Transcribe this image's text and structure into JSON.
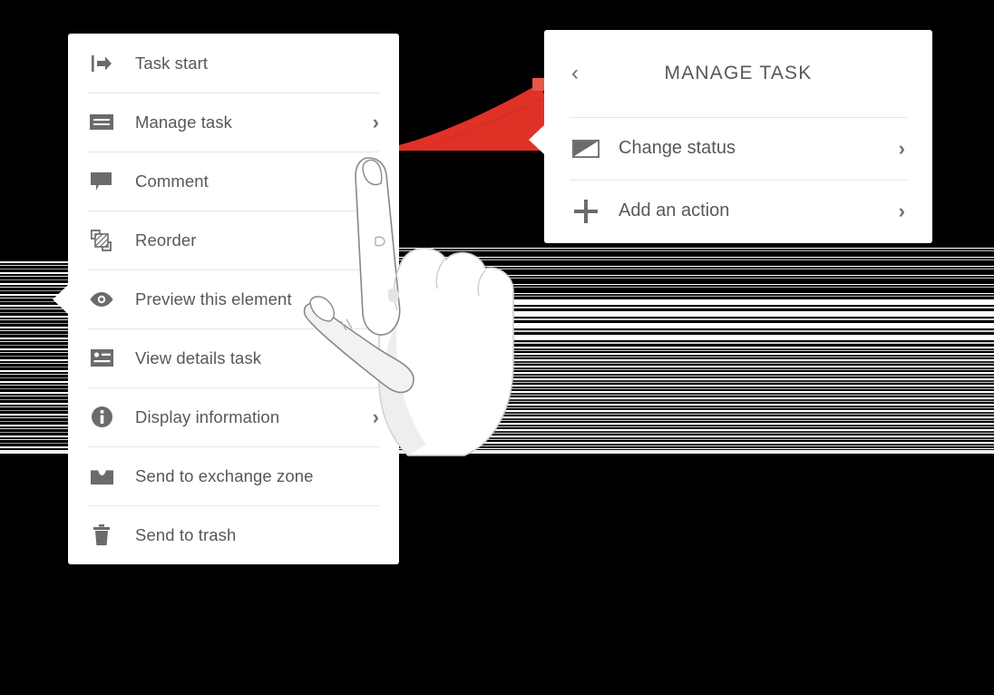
{
  "colors": {
    "panel_bg": "#ffffff",
    "text": "#58585a",
    "icon": "#6b6b6b",
    "divider": "#e6e6e6",
    "arrow_red": "#e03127",
    "arrow_head_red": "#e8564a",
    "background": "#000000"
  },
  "menu": {
    "items": [
      {
        "label": "Task start",
        "icon": "task-start-icon",
        "chevron": "",
        "has_chevron": false
      },
      {
        "label": "Manage task",
        "icon": "manage-task-icon",
        "chevron": "›",
        "has_chevron": true
      },
      {
        "label": "Comment",
        "icon": "comment-icon",
        "chevron": "›",
        "has_chevron": true
      },
      {
        "label": "Reorder",
        "icon": "reorder-icon",
        "chevron": "›",
        "has_chevron": true
      },
      {
        "label": "Preview this element",
        "icon": "eye-icon",
        "chevron": "›",
        "has_chevron": true
      },
      {
        "label": "View details task",
        "icon": "id-card-icon",
        "chevron": "›",
        "has_chevron": true
      },
      {
        "label": "Display information",
        "icon": "info-circle-icon",
        "chevron": "›",
        "has_chevron": true
      },
      {
        "label": "Send to exchange zone",
        "icon": "inbox-tray-icon",
        "chevron": "",
        "has_chevron": false
      },
      {
        "label": "Send to trash",
        "icon": "trash-icon",
        "chevron": "",
        "has_chevron": false
      }
    ]
  },
  "sub_panel": {
    "back_chevron": "‹",
    "title": "MANAGE TASK",
    "items": [
      {
        "label": "Change status",
        "icon": "status-shape-icon",
        "chevron": "›"
      },
      {
        "label": "Add an action",
        "icon": "plus-icon",
        "chevron": "›"
      }
    ]
  }
}
